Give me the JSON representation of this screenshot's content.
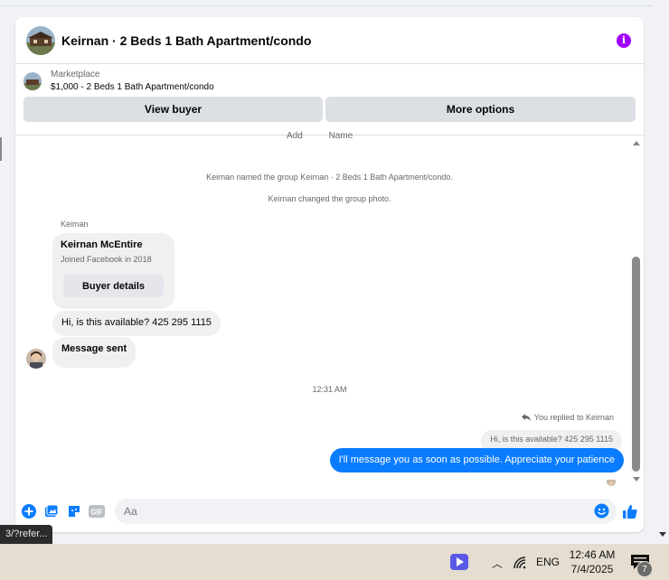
{
  "header": {
    "title": "Keirnan · 2 Beds 1 Bath Apartment/condo"
  },
  "marketplace": {
    "label": "Marketplace",
    "listing": "$1,000 - 2 Beds 1 Bath Apartment/condo",
    "buttons": {
      "view_buyer": "View buyer",
      "more_options": "More options"
    }
  },
  "thread": {
    "cut_off_labels": [
      "Add",
      "Name"
    ],
    "system_messages": [
      "Keirnan named the group Keirnan · 2 Beds 1 Bath Apartment/condo.",
      "Keirnan changed the group photo."
    ],
    "sender_label": "Keiman",
    "buyer_card": {
      "name": "Keirnan McEntire",
      "joined": "Joined Facebook in 2018",
      "button": "Buyer details"
    },
    "incoming": [
      "Hi, is this available? 425 295 1115",
      "Message sent"
    ],
    "time_separator": "12:31 AM",
    "reply": {
      "label": "You replied to Keirnan",
      "quoted": "Hi, is this available? 425 295 1115",
      "message": "I'll message you as soon as possible. Appreciate your patience"
    }
  },
  "composer": {
    "placeholder": "Aa",
    "icons": [
      "plus-circle-icon",
      "image-icon",
      "sticker-icon",
      "gif-icon",
      "emoji-icon",
      "like-icon"
    ],
    "gif_label": "GIF"
  },
  "url_tooltip": "3/?refer...",
  "taskbar": {
    "language": "ENG",
    "time": "12:46 AM",
    "date": "7/4/2025",
    "notification_count": "7"
  },
  "colors": {
    "accent": "#0a7cff",
    "info": "#a100ff",
    "bubble_in": "#f0f0f0"
  }
}
